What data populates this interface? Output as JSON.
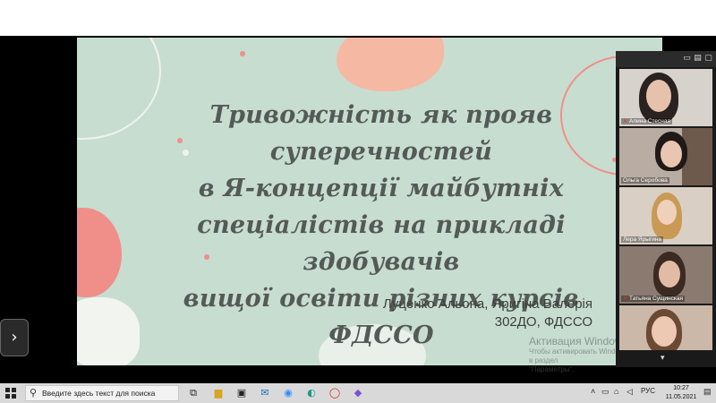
{
  "slide": {
    "title_lines": [
      "Тривожність як прояв суперечностей",
      "в Я-концепції майбутніх",
      "спеціалістів на прикладі здобувачів",
      "вищої освіти різних курсів ФДССО"
    ],
    "authors_line1": "Луценко Альона, Яригіна Валерія",
    "authors_line2": "302ДО, ФДССО"
  },
  "watermark": {
    "line1": "Активация Windows",
    "line2": "Чтобы активировать Windows, перейдите в раздел",
    "line3": "\"Параметры\"."
  },
  "gallery": {
    "participants": [
      {
        "name": "Алина Стесная",
        "muted": true
      },
      {
        "name": "Ольга Серобова",
        "muted": false
      },
      {
        "name": "Лера Ярыгина",
        "muted": false
      },
      {
        "name": "Татьяна Сущинская",
        "muted": true
      },
      {
        "name": "",
        "muted": false
      }
    ]
  },
  "taskbar": {
    "search_placeholder": "Введите здесь текст для поиска",
    "language": "РУС",
    "time": "10:27",
    "date": "11.05.2021"
  },
  "colors": {
    "slide_bg": "#c7ddd0",
    "blob_pink": "#f08f8a",
    "blob_peach": "#f5b9a3",
    "title_text": "#545a57"
  },
  "icons": {
    "next_arrow": "chevron-right-icon",
    "search": "search-icon",
    "start": "windows-start-icon"
  }
}
